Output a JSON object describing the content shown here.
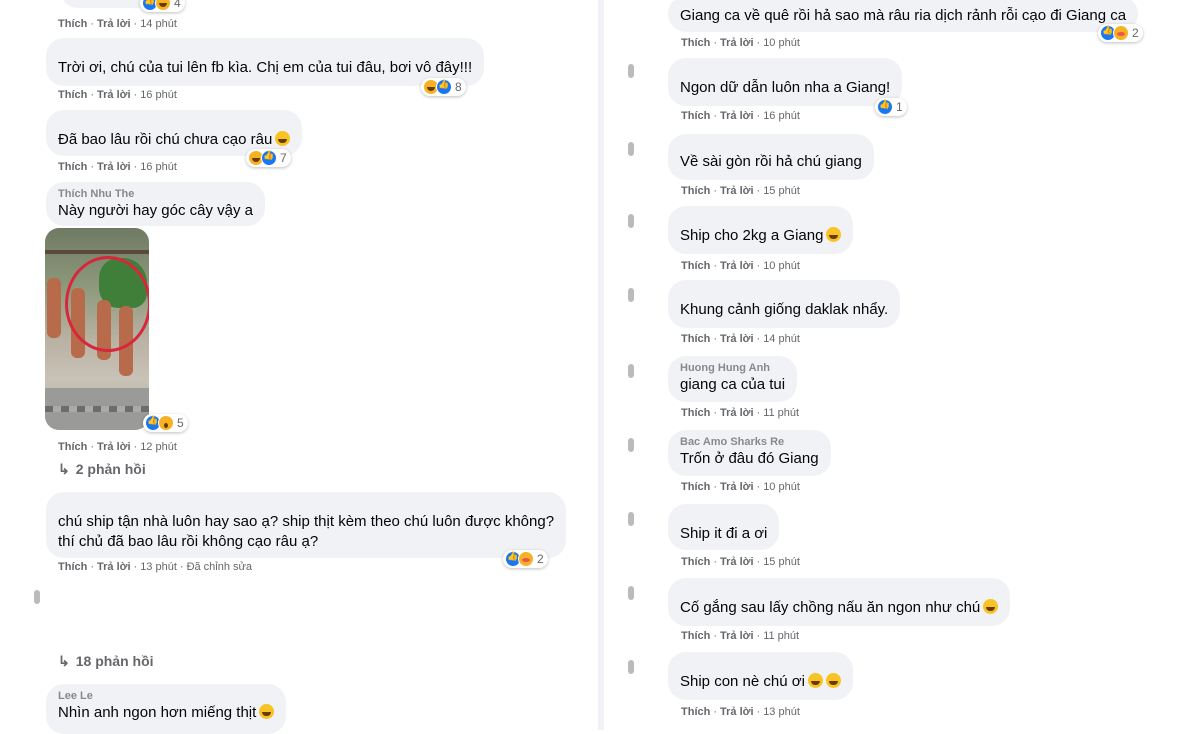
{
  "left": {
    "comments": [
      {
        "id": "c0",
        "author": "",
        "text": "",
        "actions": [
          "Thích",
          "Trả lời",
          "14 phút"
        ],
        "reactions": {
          "icons": [
            "like",
            "haha"
          ],
          "count": "4"
        }
      },
      {
        "id": "c1",
        "author": "",
        "text": "Trời ơi, chú của tui lên fb kìa. Chị em của tui đâu, bơi vô đây!!!",
        "actions": [
          "Thích",
          "Trả lời",
          "16 phút"
        ],
        "reactions": {
          "icons": [
            "haha",
            "like"
          ],
          "count": "8"
        }
      },
      {
        "id": "c2",
        "author": "",
        "text": "Đã bao lâu rồi chú chưa cạo râu",
        "actions": [
          "Thích",
          "Trả lời",
          "16 phút"
        ],
        "reactions": {
          "icons": [
            "haha",
            "like"
          ],
          "count": "7"
        }
      },
      {
        "id": "c3",
        "author": "Thích Nhu The",
        "text": "Này người hay góc cây vậy a",
        "actions": [
          "Thích",
          "Trả lời",
          "12 phút"
        ],
        "reactions": {
          "icons": [
            "like",
            "wow"
          ],
          "count": "5"
        },
        "replies": "2 phản hồi"
      },
      {
        "id": "c4",
        "author": "",
        "text_lines": [
          "chú ship tận nhà luôn hay sao ạ? ship thịt kèm theo chú luôn được không?",
          "thí chủ đã bao lâu rồi không cạo râu ạ?"
        ],
        "actions": [
          "Thích",
          "Trả lời",
          "13 phút",
          "Đã chỉnh sửa"
        ],
        "reactions": {
          "icons": [
            "like",
            "care"
          ],
          "count": "2"
        }
      },
      {
        "id": "c5",
        "replies": "18 phản hồi"
      },
      {
        "id": "c6",
        "author": "Lee Le",
        "text": "Nhìn anh ngon hơn miếng thịt"
      }
    ]
  },
  "right": {
    "comments": [
      {
        "id": "r0",
        "text": "Giang ca về quê rồi hả sao mà râu ria dịch rảnh rỗi cạo đi Giang ca",
        "actions": [
          "Thích",
          "Trả lời",
          "10 phút"
        ],
        "reactions": {
          "icons": [
            "like",
            "care"
          ],
          "count": "2"
        }
      },
      {
        "id": "r1",
        "text": "Ngon dữ dẫn luôn nha a Giang!",
        "actions": [
          "Thích",
          "Trả lời",
          "16 phút"
        ],
        "reactions": {
          "icons": [
            "like"
          ],
          "count": "1"
        }
      },
      {
        "id": "r2",
        "text": "Về sài gòn rồi hả chú giang",
        "actions": [
          "Thích",
          "Trả lời",
          "15 phút"
        ]
      },
      {
        "id": "r3",
        "text": "Ship cho 2kg a Giang",
        "actions": [
          "Thích",
          "Trả lời",
          "10 phút"
        ]
      },
      {
        "id": "r4",
        "text": "Khung cảnh giống daklak nhẩy.",
        "actions": [
          "Thích",
          "Trả lời",
          "14 phút"
        ]
      },
      {
        "id": "r5",
        "author": "Huong Hung Anh",
        "text": "giang ca của tui",
        "actions": [
          "Thích",
          "Trả lời",
          "11 phút"
        ]
      },
      {
        "id": "r6",
        "author": "Bac Amo Sharks Re",
        "text": "Trốn ở đâu đó Giang",
        "actions": [
          "Thích",
          "Trả lời",
          "10 phút"
        ]
      },
      {
        "id": "r7",
        "text": "Ship it đi a ơi",
        "actions": [
          "Thích",
          "Trả lời",
          "15 phút"
        ]
      },
      {
        "id": "r8",
        "text": "Cố gắng sau lấy chồng nấu ăn ngon như chú",
        "actions": [
          "Thích",
          "Trả lời",
          "11 phút"
        ]
      },
      {
        "id": "r9",
        "text": "Ship con nè chú ơi",
        "actions": [
          "Thích",
          "Trả lời",
          "13 phút"
        ]
      }
    ]
  },
  "colors": {
    "bubble": "#f0f2f5",
    "meta": "#65676b",
    "like": "#1877f2",
    "haha": "#f7b125",
    "photo_circle": "#d8263a"
  }
}
